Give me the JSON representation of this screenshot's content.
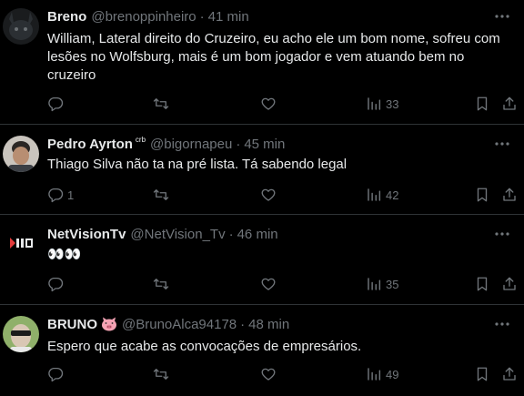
{
  "tweets": [
    {
      "name": "Breno",
      "badge": "",
      "handle": "@brenoppinheiro",
      "separator": "·",
      "time": "41 min",
      "text": "William, Lateral direito do Cruzeiro, eu acho ele um bom nome, sofreu com lesões no Wolfsburg, mais é um bom jogador e vem atuando bem no cruzeiro",
      "replies": "",
      "retweets": "",
      "likes": "",
      "views": "33"
    },
    {
      "name": "Pedro Ayrton",
      "badge": "crb",
      "handle": "@bigornapeu",
      "separator": "·",
      "time": "45 min",
      "text": "Thiago Silva não ta na pré lista. Tá sabendo legal",
      "replies": "1",
      "retweets": "",
      "likes": "",
      "views": "42"
    },
    {
      "name": "NetVisionTv",
      "badge": "",
      "handle": "@NetVision_Tv",
      "separator": "·",
      "time": "46 min",
      "text": "👀👀",
      "replies": "",
      "retweets": "",
      "likes": "",
      "views": "35"
    },
    {
      "name": "BRUNO",
      "badge": "",
      "handle": "@BrunoAlca94178",
      "separator": "·",
      "time": "48 min",
      "text": "Espero que acabe as convocações de empresários.",
      "replies": "",
      "retweets": "",
      "likes": "",
      "views": "49"
    }
  ],
  "icons": {
    "reply": "reply-icon",
    "retweet": "retweet-icon",
    "like": "heart-icon",
    "views": "views-chart-icon",
    "bookmark": "bookmark-icon",
    "share": "share-icon",
    "more": "more-options-icon",
    "emoji": "pig-face-emoji"
  },
  "colors": {
    "background": "#000000",
    "text": "#e7e9ea",
    "muted": "#71767b",
    "divider": "#2f3336"
  }
}
